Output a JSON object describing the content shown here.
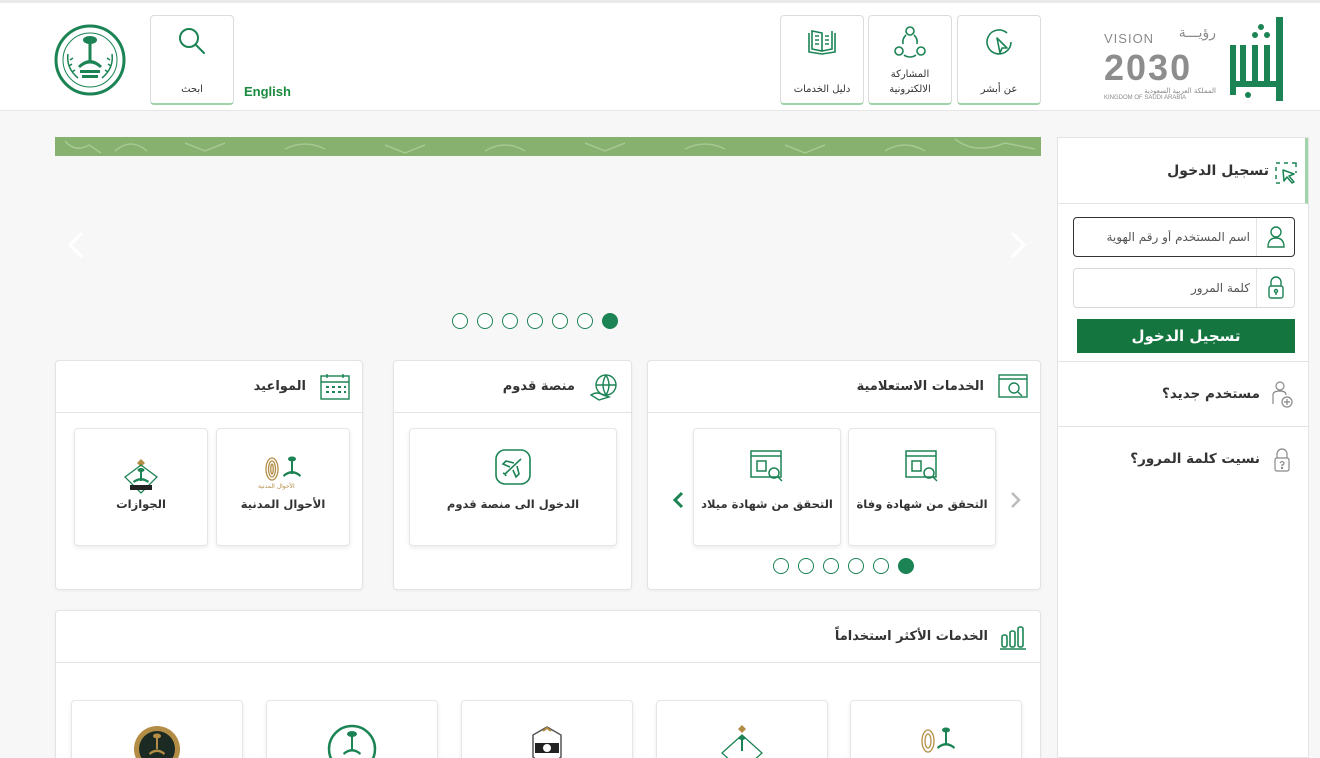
{
  "header": {
    "nav_tiles": [
      {
        "label": "عن أبشر",
        "icon": "touch-icon"
      },
      {
        "label": "المشاركة الالكترونية",
        "line1": "المشاركة",
        "line2": "الالكترونية",
        "icon": "participation-icon"
      },
      {
        "label": "دليل الخدمات",
        "icon": "book-icon"
      }
    ],
    "search_label": "ابحث",
    "language_link": "English",
    "vision": {
      "word": "VISION",
      "ar": "رؤيـــة",
      "year": "2030",
      "sub_ar": "المملكة العربية السعودية",
      "sub_en": "KINGDOM OF SAUDI ARABIA"
    }
  },
  "carousel": {
    "dots": 7,
    "active_dot_from_right": 0
  },
  "panels": {
    "inquiry": {
      "title": "الخدمات الاستعلامية",
      "cards": [
        {
          "label": "التحقق من شهادة وفاة",
          "icon": "certificate-search-icon"
        },
        {
          "label": "التحقق من شهادة ميلاد",
          "icon": "certificate-search-icon"
        }
      ],
      "dots": 6
    },
    "arrival": {
      "title": "منصة قدوم",
      "cards": [
        {
          "label": "الدخول الى منصة قدوم",
          "icon": "plane-icon"
        }
      ]
    },
    "appointments": {
      "title": "المواعيد",
      "cards": [
        {
          "label": "الأحوال المدنية",
          "icon": "civil-affairs-logo",
          "logo_text": "الأحوال المدنية"
        },
        {
          "label": "الجوازات",
          "icon": "passports-logo"
        }
      ]
    },
    "most_used": {
      "title": "الخدمات الأكثر استخداماً"
    }
  },
  "login": {
    "title": "تسجيل الدخول",
    "username_placeholder": "اسم المستخدم أو رقم الهوية",
    "password_placeholder": "كلمة المرور",
    "submit_label": "تسجيل الدخول",
    "new_user": "مستخدم جديد؟",
    "forgot_password": "نسيت كلمة المرور؟"
  },
  "colors": {
    "primary": "#1b8354",
    "button": "#14753e",
    "accent_light": "#9fd3a8",
    "gold": "#b38d45"
  }
}
